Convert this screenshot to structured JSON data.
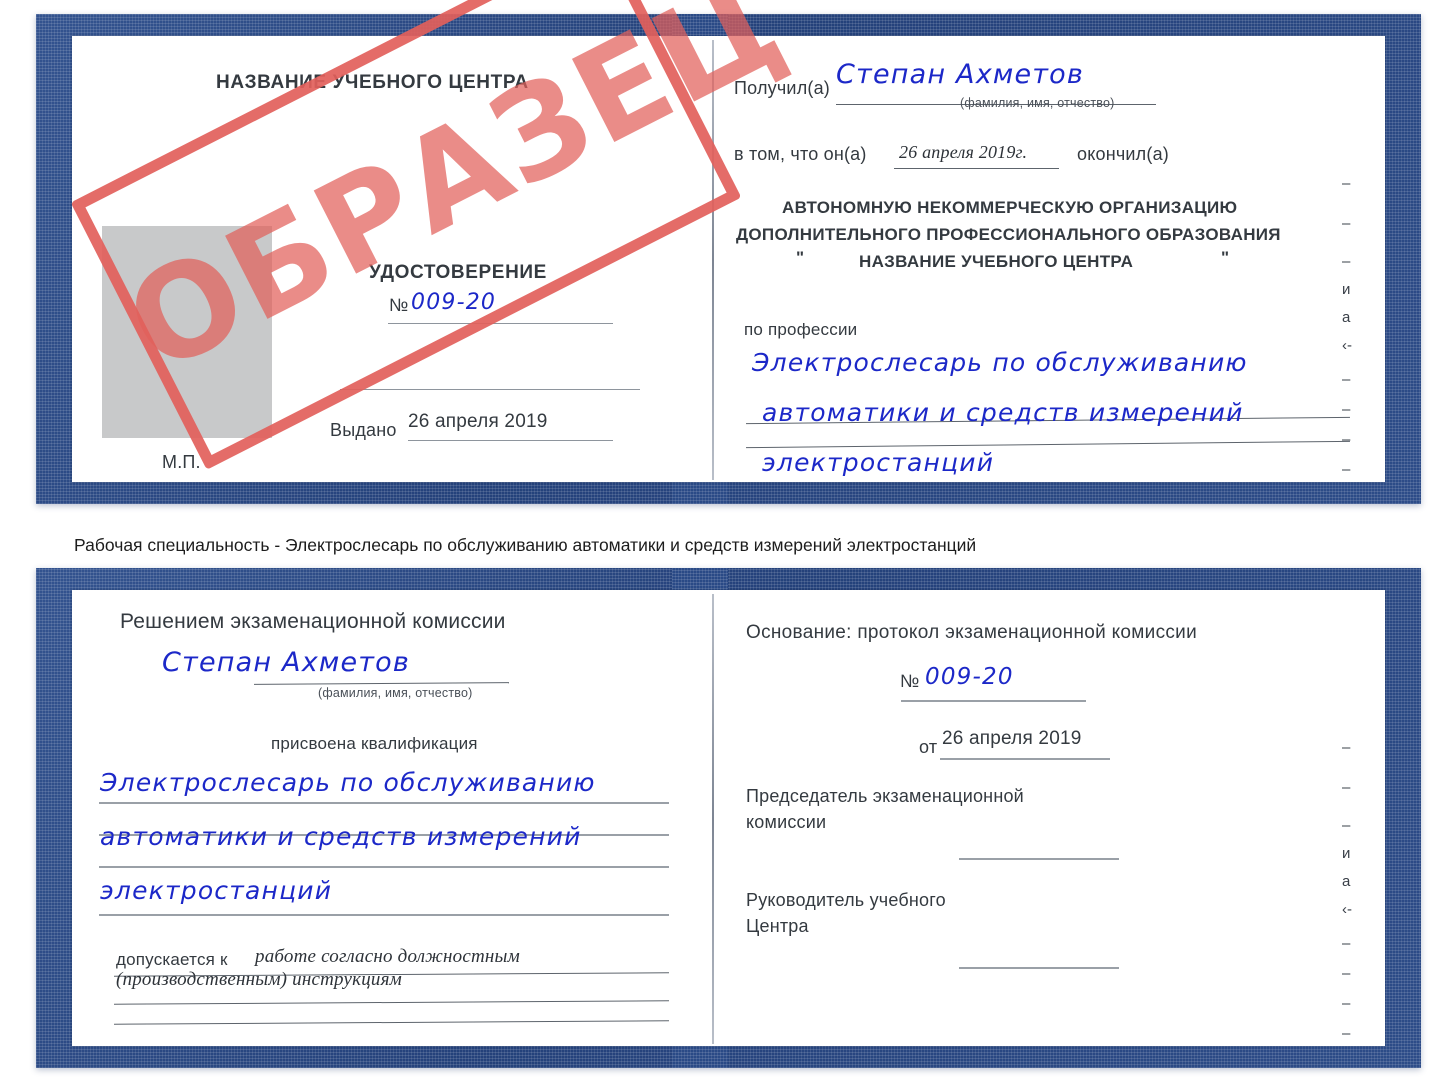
{
  "document": {
    "type": "certificate-scan",
    "colors": {
      "cover_navy": "#2a4a86",
      "stamp_red": "#e2605b",
      "handwriting_blue": "#1c28c8",
      "rule_gray": "#8e959d",
      "photo_placeholder_gray": "#c8c9ca"
    }
  },
  "stamp": {
    "text": "ОБРАЗЕЦ"
  },
  "cert_top": {
    "left_page": {
      "heading": "НАЗВАНИЕ УЧЕБНОГО ЦЕНТРА",
      "doc_type": "УДОСТОВЕРЕНИЕ",
      "number_label": "№",
      "number_value": "009-20",
      "issued_label": "Выдано",
      "issued_value": "26 апреля 2019",
      "seal_label": "М.П."
    },
    "right_page": {
      "received_label": "Получил(а)",
      "received_value": "Степан Ахметов",
      "fio_hint": "(фамилия, имя, отчество)",
      "that_he_label": "в том, что он(а)",
      "completion_date": "26 апреля 2019г.",
      "finished_label": "окончил(а)",
      "org_line1": "АВТОНОМНУЮ НЕКОММЕРЧЕСКУЮ ОРГАНИЗАЦИЮ",
      "org_line2": "ДОПОЛНИТЕЛЬНОГО ПРОФЕССИОНАЛЬНОГО ОБРАЗОВАНИЯ",
      "org_quote_open": "\"",
      "org_name": "НАЗВАНИЕ УЧЕБНОГО ЦЕНТРА",
      "org_quote_close": "\"",
      "profession_label": "по профессии",
      "profession_line1": "Электрослесарь по обслуживанию",
      "profession_line2": "автоматики и средств измерений",
      "profession_line3": "электростанций",
      "edge_glyphs": [
        "–",
        "–",
        "–",
        "и",
        "а",
        "‹-",
        "–",
        "–",
        "–",
        "–"
      ]
    }
  },
  "caption": {
    "text": "Рабочая специальность - Электрослесарь по обслуживанию автоматики и средств измерений электростанций"
  },
  "cert_bottom": {
    "left_page": {
      "heading": "Решением экзаменационной комиссии",
      "name_value": "Степан Ахметов",
      "fio_hint": "(фамилия, имя, отчество)",
      "qualification_label": "присвоена квалификация",
      "qualification_line1": "Электрослесарь по обслуживанию",
      "qualification_line2": "автоматики и средств измерений",
      "qualification_line3": "электростанций",
      "admitted_label": "допускается к",
      "admitted_line1": "работе согласно должностным",
      "admitted_line2": "(производственным) инструкциям"
    },
    "right_page": {
      "basis_label": "Основание: протокол экзаменационной комиссии",
      "protocol_number_label": "№",
      "protocol_number_value": "009-20",
      "protocol_date_label": "от",
      "protocol_date_value": "26 апреля 2019",
      "chairman_line1": "Председатель экзаменационной",
      "chairman_line2": "комиссии",
      "head_line1": "Руководитель учебного",
      "head_line2": "Центра",
      "edge_glyphs": [
        "–",
        "–",
        "–",
        "и",
        "а",
        "‹-",
        "–",
        "–",
        "–",
        "–"
      ]
    }
  }
}
